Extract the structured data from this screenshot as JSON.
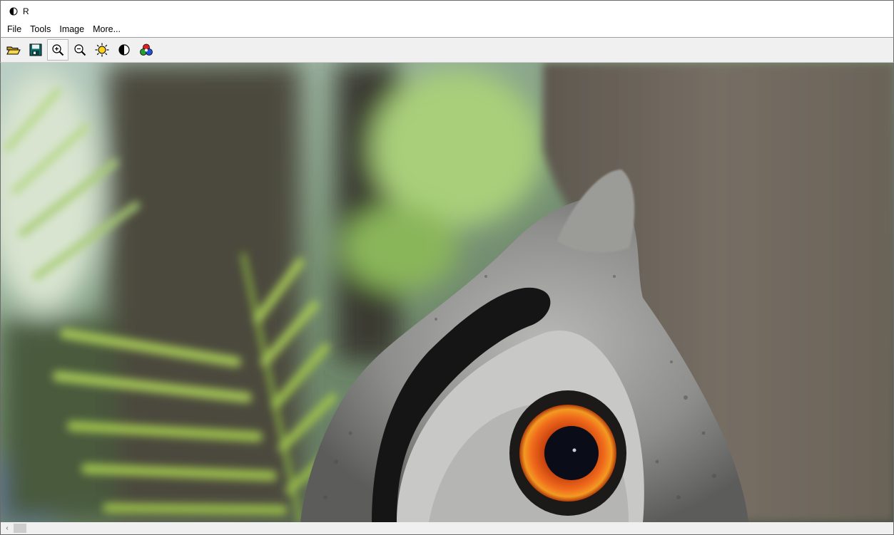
{
  "window": {
    "title": "R",
    "icon": "half-circle-contrast-icon"
  },
  "menu": {
    "items": [
      "File",
      "Tools",
      "Image",
      "More..."
    ]
  },
  "toolbar": {
    "buttons": [
      {
        "name": "open-folder-icon",
        "active": false
      },
      {
        "name": "save-disk-icon",
        "active": false
      },
      {
        "name": "zoom-in-icon",
        "active": true
      },
      {
        "name": "zoom-out-icon",
        "active": false
      },
      {
        "name": "brightness-sun-icon",
        "active": false
      },
      {
        "name": "contrast-icon",
        "active": false
      },
      {
        "name": "color-balance-rgb-icon",
        "active": false
      }
    ]
  },
  "image": {
    "subject": "owl close-up photo",
    "colors": {
      "eye_iris": "#e8501a",
      "eye_ring": "#f0a020",
      "pupil": "#0a0d18",
      "feathers": "#9a9a98",
      "bark": "#6e675d",
      "foliage": "#8fb840"
    }
  },
  "scrollbar": {
    "left_arrow": "‹"
  }
}
